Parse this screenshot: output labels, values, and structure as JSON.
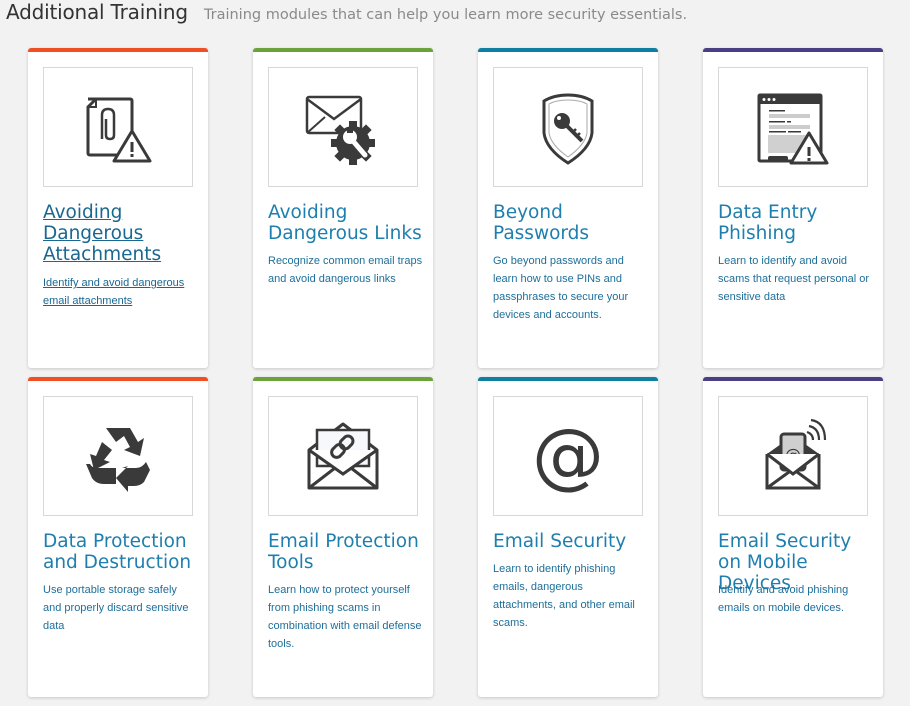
{
  "header": {
    "title": "Additional Training",
    "subtitle": "Training modules that can help you learn more security essentials."
  },
  "colors": {
    "orange": "#f04e23",
    "green": "#6aa339",
    "teal": "#0e7fa3",
    "purple": "#4a3f85",
    "link": "#1e7fae",
    "icon": "#3a3a3a"
  },
  "cards": [
    {
      "title": "Avoiding Dangerous Attachments",
      "description": "Identify and avoid dangerous email attachments",
      "icon": "attachment-warning-icon",
      "accent": "orange",
      "hovered": true
    },
    {
      "title": "Avoiding Dangerous Links",
      "description": "Recognize common email traps and avoid dangerous links",
      "icon": "email-gear-wrench-icon",
      "accent": "green"
    },
    {
      "title": "Beyond Passwords",
      "description": "Go beyond passwords and learn how to use PINs and passphrases to secure your devices and accounts.",
      "icon": "shield-key-icon",
      "accent": "teal"
    },
    {
      "title": "Data Entry Phishing",
      "description": "Learn to identify and avoid scams that request personal or sensitive data",
      "icon": "web-form-warning-icon",
      "accent": "purple"
    },
    {
      "title": "Data Protection and Destruction",
      "description": "Use portable storage safely and properly discard sensitive data",
      "icon": "recycle-icon",
      "accent": "orange"
    },
    {
      "title": "Email Protection Tools",
      "description": "Learn how to protect yourself from phishing scams in combination with email defense tools.",
      "icon": "envelope-link-icon",
      "accent": "green"
    },
    {
      "title": "Email Security",
      "description": "Learn to identify phishing emails, dangerous attachments, and other email scams.",
      "icon": "at-sign-icon",
      "accent": "teal"
    },
    {
      "title": "Email Security on Mobile Devices",
      "description": "Identify and avoid phishing emails on mobile devices.",
      "icon": "mobile-email-icon",
      "accent": "purple"
    }
  ]
}
